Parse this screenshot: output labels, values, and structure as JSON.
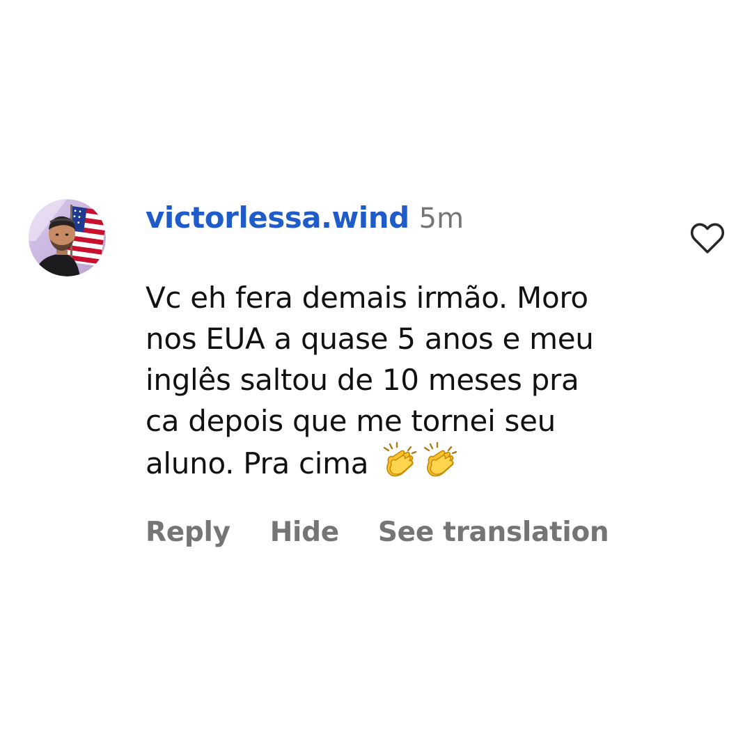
{
  "comment": {
    "username": "victorlessa.wind",
    "timestamp": "5m",
    "text_lines": [
      "Vc eh fera demais irmão. Moro",
      "nos EUA a quase 5 anos e meu",
      "inglês saltou de 10 meses pra",
      "ca depois que me tornei seu",
      "aluno. Pra cima"
    ],
    "emoji": [
      "clapping-hands",
      "clapping-hands"
    ],
    "avatar": "profile-photo-with-us-flag",
    "like_icon": "heart-outline-icon"
  },
  "actions": {
    "reply": "Reply",
    "hide": "Hide",
    "see_translation": "See translation"
  },
  "colors": {
    "username": "#1f5cc9",
    "secondary": "#757575",
    "text": "#111111",
    "background": "#ffffff"
  }
}
